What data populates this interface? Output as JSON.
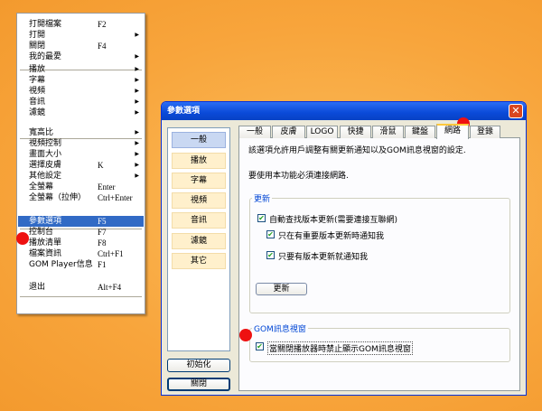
{
  "menu": {
    "items": [
      {
        "label": "打開檔案",
        "shortcut": "F2"
      },
      {
        "label": "打開",
        "submenu": "▶"
      },
      {
        "label": "關閉",
        "shortcut": "F4"
      },
      {
        "label": "我的最愛",
        "submenu": "▶"
      },
      {
        "label": "播放",
        "submenu": "▶"
      },
      {
        "label": "字幕",
        "submenu": "▶"
      },
      {
        "label": "視頻",
        "submenu": "▶"
      },
      {
        "label": "音訊",
        "submenu": "▶"
      },
      {
        "label": "濾鏡",
        "submenu": "▶"
      },
      {
        "label": "寬高比",
        "submenu": "▶"
      },
      {
        "label": "視頻控制",
        "submenu": "▶"
      },
      {
        "label": "畫面大小",
        "submenu": "▶"
      },
      {
        "label": "選擇皮膚",
        "shortcut": "K",
        "submenu": "▶"
      },
      {
        "label": "其他設定",
        "submenu": "▶"
      },
      {
        "label": "全螢幕",
        "shortcut": "Enter"
      },
      {
        "label": "全螢幕（拉伸）",
        "shortcut": "Ctrl+Enter"
      },
      {
        "label": "參數選項",
        "shortcut": "F5",
        "highlighted": true
      },
      {
        "label": "控制台",
        "shortcut": "F7"
      },
      {
        "label": "播放清單",
        "shortcut": "F8"
      },
      {
        "label": "檔案資訊",
        "shortcut": "Ctrl+F1"
      },
      {
        "label": "GOM Player信息",
        "shortcut": "F1"
      },
      {
        "label": "退出",
        "shortcut": "Alt+F4"
      }
    ]
  },
  "dialog": {
    "title": "參數選項",
    "close": "✕",
    "side_items": [
      "一般",
      "播放",
      "字幕",
      "視頻",
      "音訊",
      "濾鏡",
      "其它"
    ],
    "reset_button": "初始化",
    "close_button": "關閉",
    "tabs": [
      "一般",
      "皮膚",
      "LOGO",
      "快捷",
      "滑鼠",
      "鍵盤",
      "網路",
      "登錄"
    ],
    "selected_tab": "網路",
    "desc1": "該選項允許用戶調整有關更新通知以及GOM訊息視窗的設定.",
    "desc2": "要使用本功能必須連接網路.",
    "update_group": {
      "label": "更新",
      "checks": [
        {
          "label": "自動查找版本更新(需要連接互聯網)",
          "checked": true
        },
        {
          "label": "只在有重要版本更新時通知我",
          "checked": true
        },
        {
          "label": "只要有版本更新就通知我",
          "checked": true
        }
      ],
      "button": "更新"
    },
    "gom_group": {
      "label": "GOM訊息視窗",
      "check": {
        "label": "當關閉播放器時禁止顯示GOM訊息視窗",
        "checked": true
      }
    }
  },
  "check_mark": "✔",
  "colors": {
    "highlight": "#316ac5",
    "marker": "#ee1111",
    "titlebar": "#0a4ad8"
  }
}
